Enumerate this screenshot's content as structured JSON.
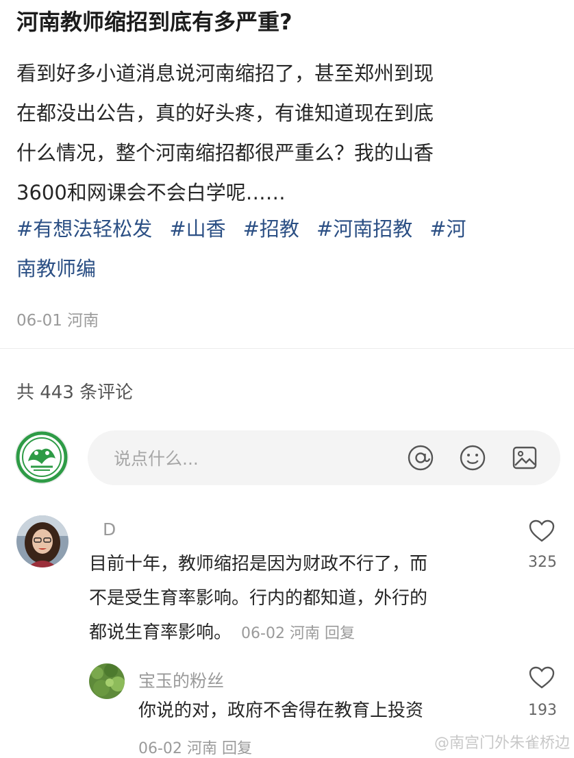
{
  "post": {
    "title": "河南教师缩招到底有多严重?",
    "body_lines": [
      "看到好多小道消息说河南缩招了，甚至郑州到现",
      "在都没出公告，真的好头疼，有谁知道现在到底",
      "什么情况，整个河南缩招都很严重么？我的山香",
      "3600和网课会不会白学呢……"
    ],
    "tags_line1": [
      "#有想法轻松发",
      "#山香",
      "#招教",
      "#河南招教",
      "#河"
    ],
    "tags_line2": "南教师编",
    "date": "06-01",
    "location": "河南"
  },
  "comments_count_text": "共 443 条评论",
  "comment_input": {
    "placeholder": "说点什么...",
    "icons": [
      "at-icon",
      "emoji-icon",
      "image-icon"
    ]
  },
  "comments": [
    {
      "author": "D",
      "text_lines": [
        "目前十年，教师缩招是因为财政不行了，而",
        "不是受生育率影响。行内的都知道，外行的",
        "都说生育率影响。"
      ],
      "date": "06-02",
      "location": "河南",
      "reply_label": "回复",
      "likes": "325"
    },
    {
      "author": "宝玉的粉丝",
      "text_lines": [
        "你说的对，政府不舍得在教育上投资"
      ],
      "date": "06-02",
      "location": "河南",
      "reply_label": "回复",
      "likes": "193"
    }
  ],
  "watermark": "@南宫门外朱雀桥边",
  "colors": {
    "tag": "#2b4f84",
    "muted": "#9a9a9a",
    "input_bg": "#f4f4f4",
    "seal_green": "#2e9b46"
  }
}
